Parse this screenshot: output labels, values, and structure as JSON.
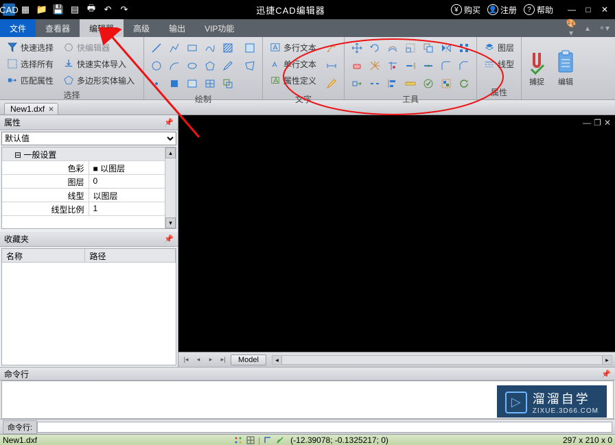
{
  "app": {
    "title": "迅捷CAD编辑器",
    "logo": "CAD"
  },
  "titlebar_right": {
    "buy": "购买",
    "register": "注册",
    "help": "帮助"
  },
  "tabs": {
    "file": "文件",
    "viewer": "查看器",
    "editor": "编辑器",
    "advanced": "高级",
    "output": "输出",
    "vip": "VIP功能"
  },
  "ribbon": {
    "select": {
      "label": "选择",
      "quick_select": "快速选择",
      "quick_edit": "快编辑器",
      "select_all": "选择所有",
      "quick_solid_import": "快速实体导入",
      "match_props": "匹配属性",
      "polygon_solid_input": "多边形实体输入"
    },
    "draw": {
      "label": "绘制"
    },
    "text": {
      "label": "文字",
      "mtext": "多行文本",
      "stext": "单行文本",
      "attdef": "属性定义"
    },
    "tools": {
      "label": "工具"
    },
    "props": {
      "label": "属性",
      "layer": "图层",
      "linetype": "线型"
    },
    "snap": "捕捉",
    "edit": "编辑"
  },
  "file_tab": {
    "name": "New1.dxf"
  },
  "panels": {
    "properties": {
      "title": "属性",
      "dropdown": "默认值",
      "section": "一般设置",
      "rows": {
        "color": {
          "k": "色彩",
          "v": "以图层"
        },
        "layer": {
          "k": "图层",
          "v": "0"
        },
        "linetype": {
          "k": "线型",
          "v": "以图层"
        },
        "ltscale": {
          "k": "线型比例",
          "v": "1"
        }
      }
    },
    "favorites": {
      "title": "收藏夹",
      "col_name": "名称",
      "col_path": "路径"
    }
  },
  "model_tab": "Model",
  "command": {
    "title": "命令行",
    "prompt": "命令行:"
  },
  "statusbar": {
    "file": "New1.dxf",
    "coords": "(-12.39078; -0.1325217; 0)",
    "dims": "297 x 210 x 0"
  },
  "watermark": {
    "brand": "溜溜自学",
    "url": "ZIXUE.3D66.COM"
  }
}
